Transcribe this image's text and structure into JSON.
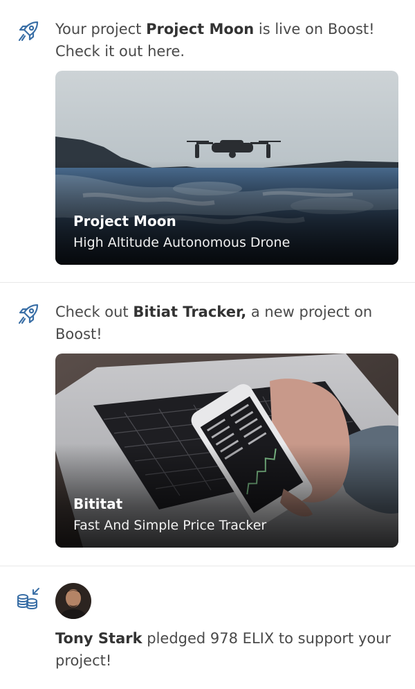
{
  "feed": {
    "items": [
      {
        "icon": "rocket-icon",
        "message_prefix": "Your project ",
        "message_bold": "Project Moon",
        "message_suffix": " is live on Boost! Check it out here.",
        "card": {
          "title": "Project Moon",
          "subtitle": "High Altitude Autonomous Drone"
        }
      },
      {
        "icon": "rocket-icon",
        "message_prefix": "Check out ",
        "message_bold": "Bitiat Tracker,",
        "message_suffix": " a new project on Boost!",
        "card": {
          "title": "Bititat",
          "subtitle": "Fast And Simple Price Tracker"
        }
      },
      {
        "icon": "coins-pledge-icon",
        "avatar": "user-avatar",
        "message_bold": "Tony Stark",
        "message_suffix": " pledged 978 ELIX to support your project!"
      }
    ]
  },
  "colors": {
    "icon_blue": "#3a6fa6",
    "text": "#4a4a4a",
    "divider": "#e8e8e8"
  }
}
